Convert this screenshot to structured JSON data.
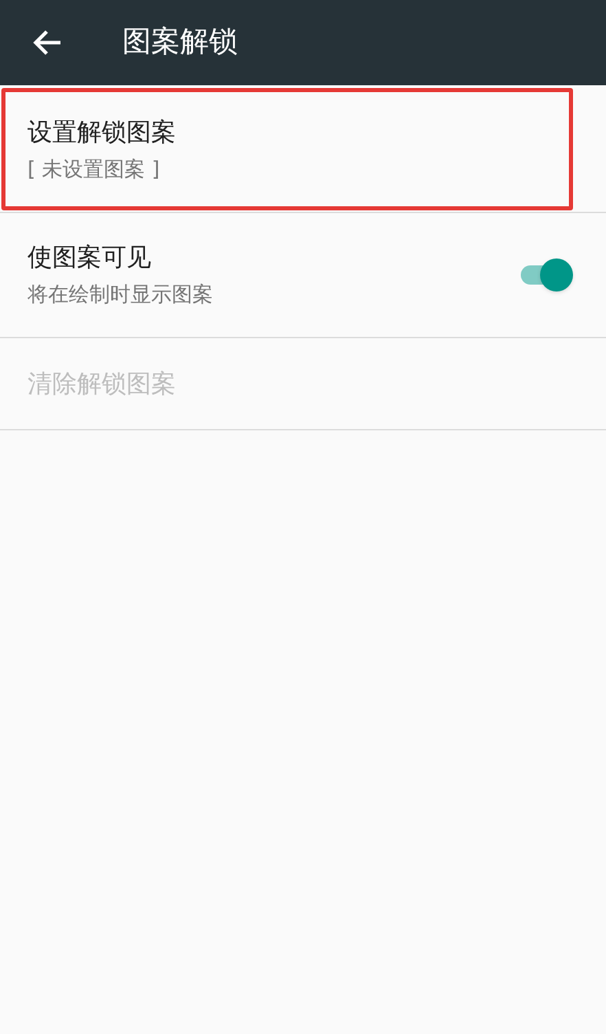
{
  "header": {
    "title": "图案解锁"
  },
  "items": [
    {
      "kind": "text",
      "title": "设置解锁图案",
      "summary": "[ 未设置图案 ]",
      "highlighted": true,
      "disabled": false
    },
    {
      "kind": "switch",
      "title": "使图案可见",
      "summary": "将在绘制时显示图案",
      "on": true,
      "disabled": false
    },
    {
      "kind": "text",
      "title": "清除解锁图案",
      "disabled": true
    }
  ]
}
